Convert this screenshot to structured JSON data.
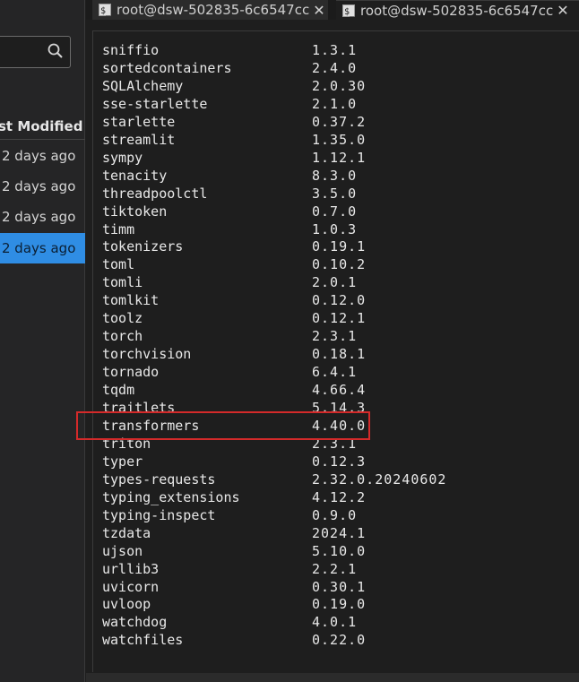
{
  "file_browser": {
    "column_header": "st Modified",
    "rows": [
      {
        "modified": "2 days ago",
        "selected": false
      },
      {
        "modified": "2 days ago",
        "selected": false
      },
      {
        "modified": "2 days ago",
        "selected": false
      },
      {
        "modified": "2 days ago",
        "selected": true
      }
    ]
  },
  "tabs": [
    {
      "label": "root@dsw-502835-6c6547cc",
      "icon": "terminal-icon",
      "close": "✕"
    },
    {
      "label": "root@dsw-502835-6c6547cc",
      "icon": "terminal-icon",
      "close": "✕"
    }
  ],
  "terminal": {
    "packages": [
      {
        "name": "sniffio",
        "version": "1.3.1"
      },
      {
        "name": "sortedcontainers",
        "version": "2.4.0"
      },
      {
        "name": "SQLAlchemy",
        "version": "2.0.30"
      },
      {
        "name": "sse-starlette",
        "version": "2.1.0"
      },
      {
        "name": "starlette",
        "version": "0.37.2"
      },
      {
        "name": "streamlit",
        "version": "1.35.0"
      },
      {
        "name": "sympy",
        "version": "1.12.1"
      },
      {
        "name": "tenacity",
        "version": "8.3.0"
      },
      {
        "name": "threadpoolctl",
        "version": "3.5.0"
      },
      {
        "name": "tiktoken",
        "version": "0.7.0"
      },
      {
        "name": "timm",
        "version": "1.0.3"
      },
      {
        "name": "tokenizers",
        "version": "0.19.1"
      },
      {
        "name": "toml",
        "version": "0.10.2"
      },
      {
        "name": "tomli",
        "version": "2.0.1"
      },
      {
        "name": "tomlkit",
        "version": "0.12.0"
      },
      {
        "name": "toolz",
        "version": "0.12.1"
      },
      {
        "name": "torch",
        "version": "2.3.1"
      },
      {
        "name": "torchvision",
        "version": "0.18.1"
      },
      {
        "name": "tornado",
        "version": "6.4.1"
      },
      {
        "name": "tqdm",
        "version": "4.66.4"
      },
      {
        "name": "traitlets",
        "version": "5.14.3"
      },
      {
        "name": "transformers",
        "version": "4.40.0"
      },
      {
        "name": "triton",
        "version": "2.3.1"
      },
      {
        "name": "typer",
        "version": "0.12.3"
      },
      {
        "name": "types-requests",
        "version": "2.32.0.20240602"
      },
      {
        "name": "typing_extensions",
        "version": "4.12.2"
      },
      {
        "name": "typing-inspect",
        "version": "0.9.0"
      },
      {
        "name": "tzdata",
        "version": "2024.1"
      },
      {
        "name": "ujson",
        "version": "5.10.0"
      },
      {
        "name": "urllib3",
        "version": "2.2.1"
      },
      {
        "name": "uvicorn",
        "version": "0.30.1"
      },
      {
        "name": "uvloop",
        "version": "0.19.0"
      },
      {
        "name": "watchdog",
        "version": "4.0.1"
      },
      {
        "name": "watchfiles",
        "version": "0.22.0"
      }
    ],
    "highlighted_package": "transformers",
    "highlight_color": "#d42a2a"
  }
}
